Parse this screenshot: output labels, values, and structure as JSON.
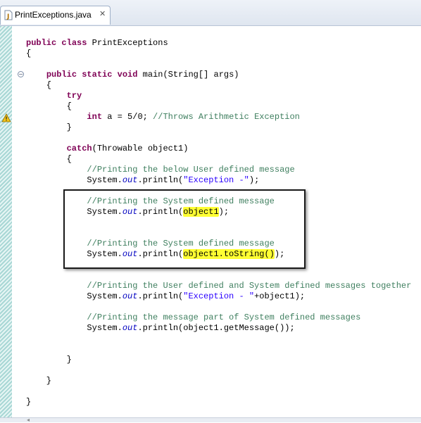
{
  "tab": {
    "title": "PrintExceptions.java",
    "close_glyph": "✕",
    "icon": "java-file-icon"
  },
  "code": {
    "lines": [
      "public class PrintExceptions",
      "{",
      "",
      "    public static void main(String[] args)",
      "    {",
      "        try",
      "        {",
      "            int a = 5/0; //Throws Arithmetic Exception",
      "        }",
      "",
      "        catch(Throwable object1)",
      "        {",
      "            //Printing the below User defined message",
      "            System.out.println(\"Exception -\");",
      "",
      "            //Printing the System defined message",
      "            System.out.println(object1);",
      "",
      "",
      "            //Printing the System defined message",
      "            System.out.println(object1.toString());",
      "",
      "",
      "            //Printing the User defined and System defined messages together",
      "            System.out.println(\"Exception - \"+object1);",
      "",
      "            //Printing the message part of System defined messages",
      "            System.out.println(object1.getMessage());",
      "",
      "",
      "        }",
      "",
      "    }",
      "",
      "}"
    ],
    "highlights": [
      "object1",
      "object1.toString()"
    ]
  },
  "colors": {
    "keyword": "#7f0055",
    "comment": "#3f7f5f",
    "string": "#2a00ff",
    "field": "#0000c0",
    "highlight": "#ffff33"
  }
}
